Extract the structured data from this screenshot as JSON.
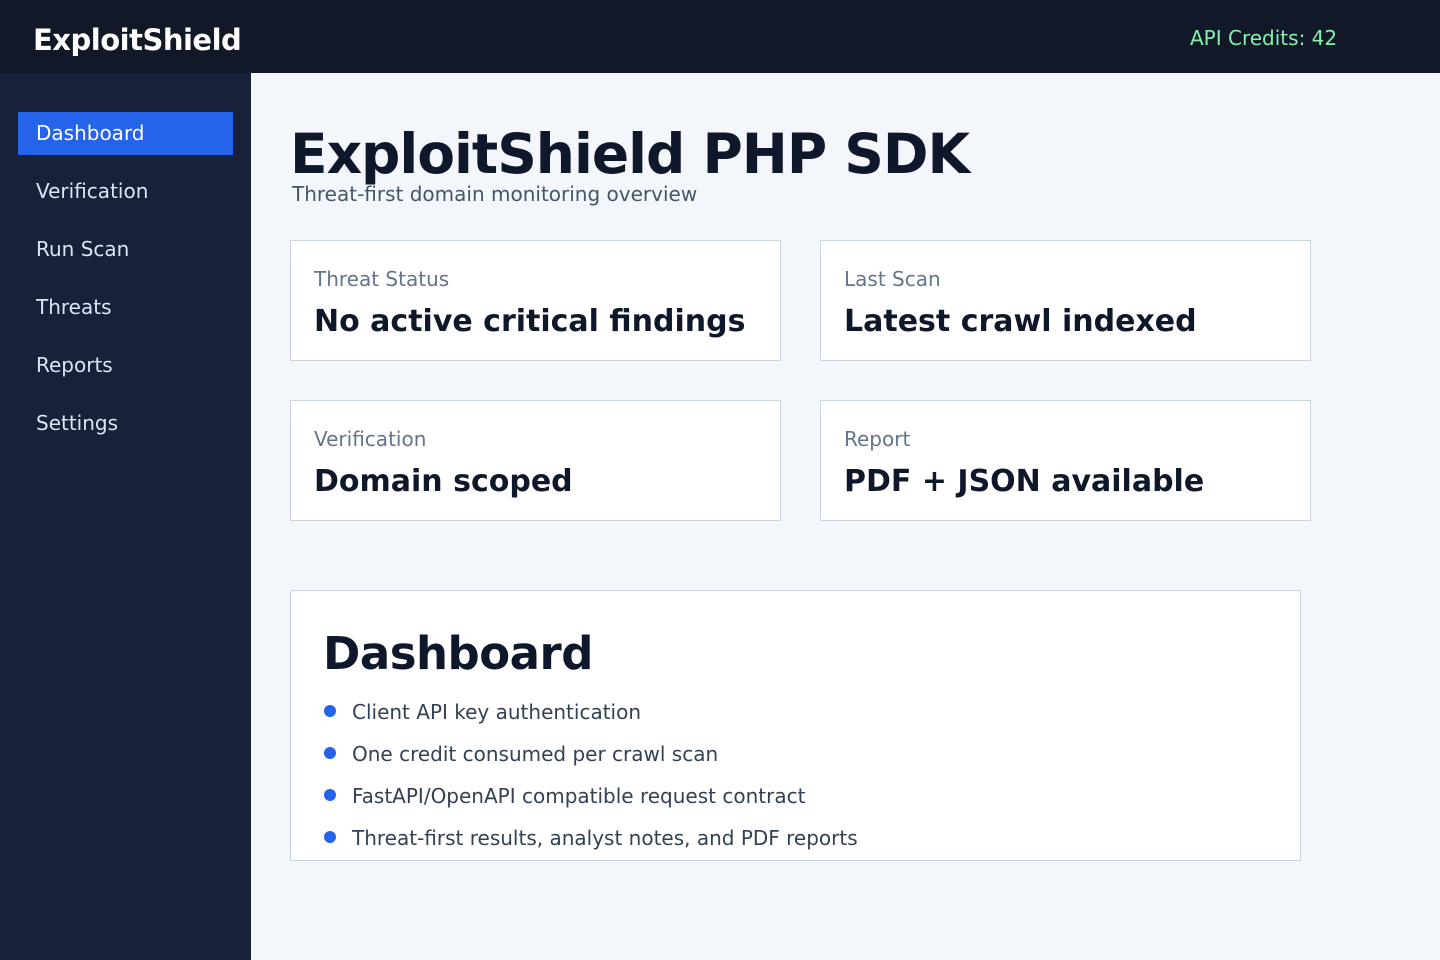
{
  "app": {
    "brand": "ExploitShield"
  },
  "header": {
    "credits_text": "API Credits: 42"
  },
  "sidebar": {
    "items": [
      {
        "label": "Dashboard",
        "active": true
      },
      {
        "label": "Verification"
      },
      {
        "label": "Run Scan"
      },
      {
        "label": "Threats"
      },
      {
        "label": "Reports"
      },
      {
        "label": "Settings"
      }
    ]
  },
  "page": {
    "title": "ExploitShield PHP SDK",
    "subtitle": "Threat-first domain monitoring overview"
  },
  "cards": [
    {
      "label": "Threat Status",
      "value": "No active critical findings"
    },
    {
      "label": "Last Scan",
      "value": "Latest crawl indexed"
    },
    {
      "label": "Verification",
      "value": "Domain scoped"
    },
    {
      "label": "Report",
      "value": "PDF + JSON available"
    }
  ],
  "panel": {
    "title": "Dashboard",
    "bullets": [
      "Client API key authentication",
      "One credit consumed per crawl scan",
      "FastAPI/OpenAPI compatible request contract",
      "Threat-first results, analyst notes, and PDF reports"
    ]
  },
  "colors": {
    "accent": "#2563eb",
    "topbar": "#111827",
    "sidebar": "#18213a",
    "credits": "#86efac"
  }
}
